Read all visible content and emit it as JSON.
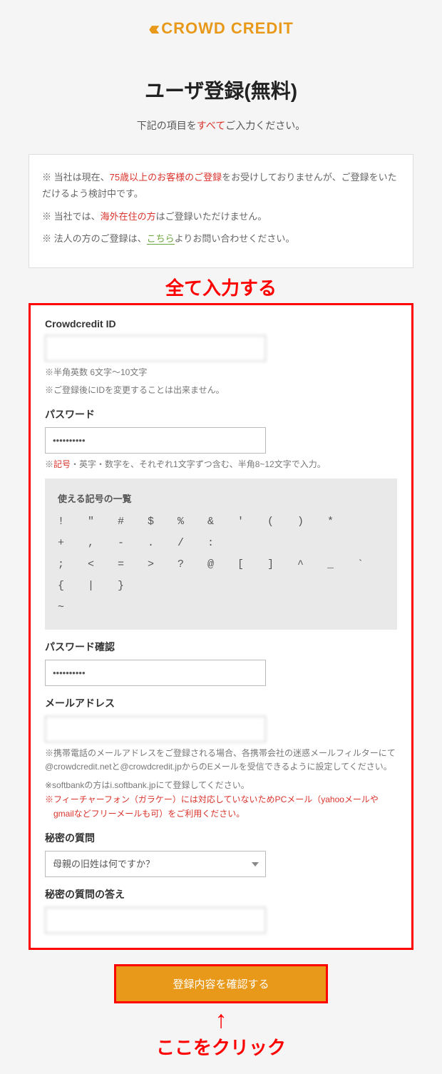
{
  "logo": {
    "text": "CROWD CREDIT"
  },
  "page_title": "ユーザ登録(無料)",
  "subtitle_prefix": "下記の項目を",
  "subtitle_red": "すべて",
  "subtitle_suffix": "ご入力ください。",
  "notice": {
    "l1_a": "※ 当社は現在、",
    "l1_red": "75歳以上のお客様のご登録",
    "l1_b": "をお受けしておりませんが、ご登録をいただけるよう検討中です。",
    "l2_a": "※ 当社では、",
    "l2_red": "海外在住の方",
    "l2_b": "はご登録いただけません。",
    "l3_a": "※ 法人の方のご登録は、",
    "l3_link": "こちら",
    "l3_b": "よりお問い合わせください。"
  },
  "annotations": {
    "top": "全て入力する",
    "bottom": "ここをクリック"
  },
  "fields": {
    "id": {
      "label": "Crowdcredit ID",
      "value": "　　　",
      "help1": "※半角英数 6文字〜10文字",
      "help2": "※ご登録後にIDを変更することは出来ません。"
    },
    "password": {
      "label": "パスワード",
      "value": "••••••••••",
      "help_a": "※",
      "help_red": "記号",
      "help_b": "・英字・数字を、それぞれ1文字ずつ含む、半角8~12文字で入力。"
    },
    "symbols": {
      "title": "使える記号の一覧",
      "row1": "! \" # $ % & ' ( ) *",
      "row2": "+ , - . / :",
      "row3": "; < = > ? @ [ ] ^ _ ` { | }",
      "row4": "~"
    },
    "password_confirm": {
      "label": "パスワード確認",
      "value": "••••••••••"
    },
    "email": {
      "label": "メールアドレス",
      "value": "　　　　　　　　　",
      "help1": "※携帯電話のメールアドレスをご登録される場合、各携帯会社の迷惑メールフィルターにて@crowdcredit.netと@crowdcredit.jpからのEメールを受信できるように設定してください。",
      "help2": "※softbankの方はi.softbank.jpにて登録してください。",
      "help_red": "※フィーチャーフォン（ガラケー）には対応していないためPCメール（yahooメールやgmailなどフリーメールも可）をご利用ください。"
    },
    "question": {
      "label": "秘密の質問",
      "selected": "母親の旧姓は何ですか？"
    },
    "answer": {
      "label": "秘密の質問の答え",
      "value": "　　　"
    }
  },
  "submit_label": "登録内容を確認する"
}
